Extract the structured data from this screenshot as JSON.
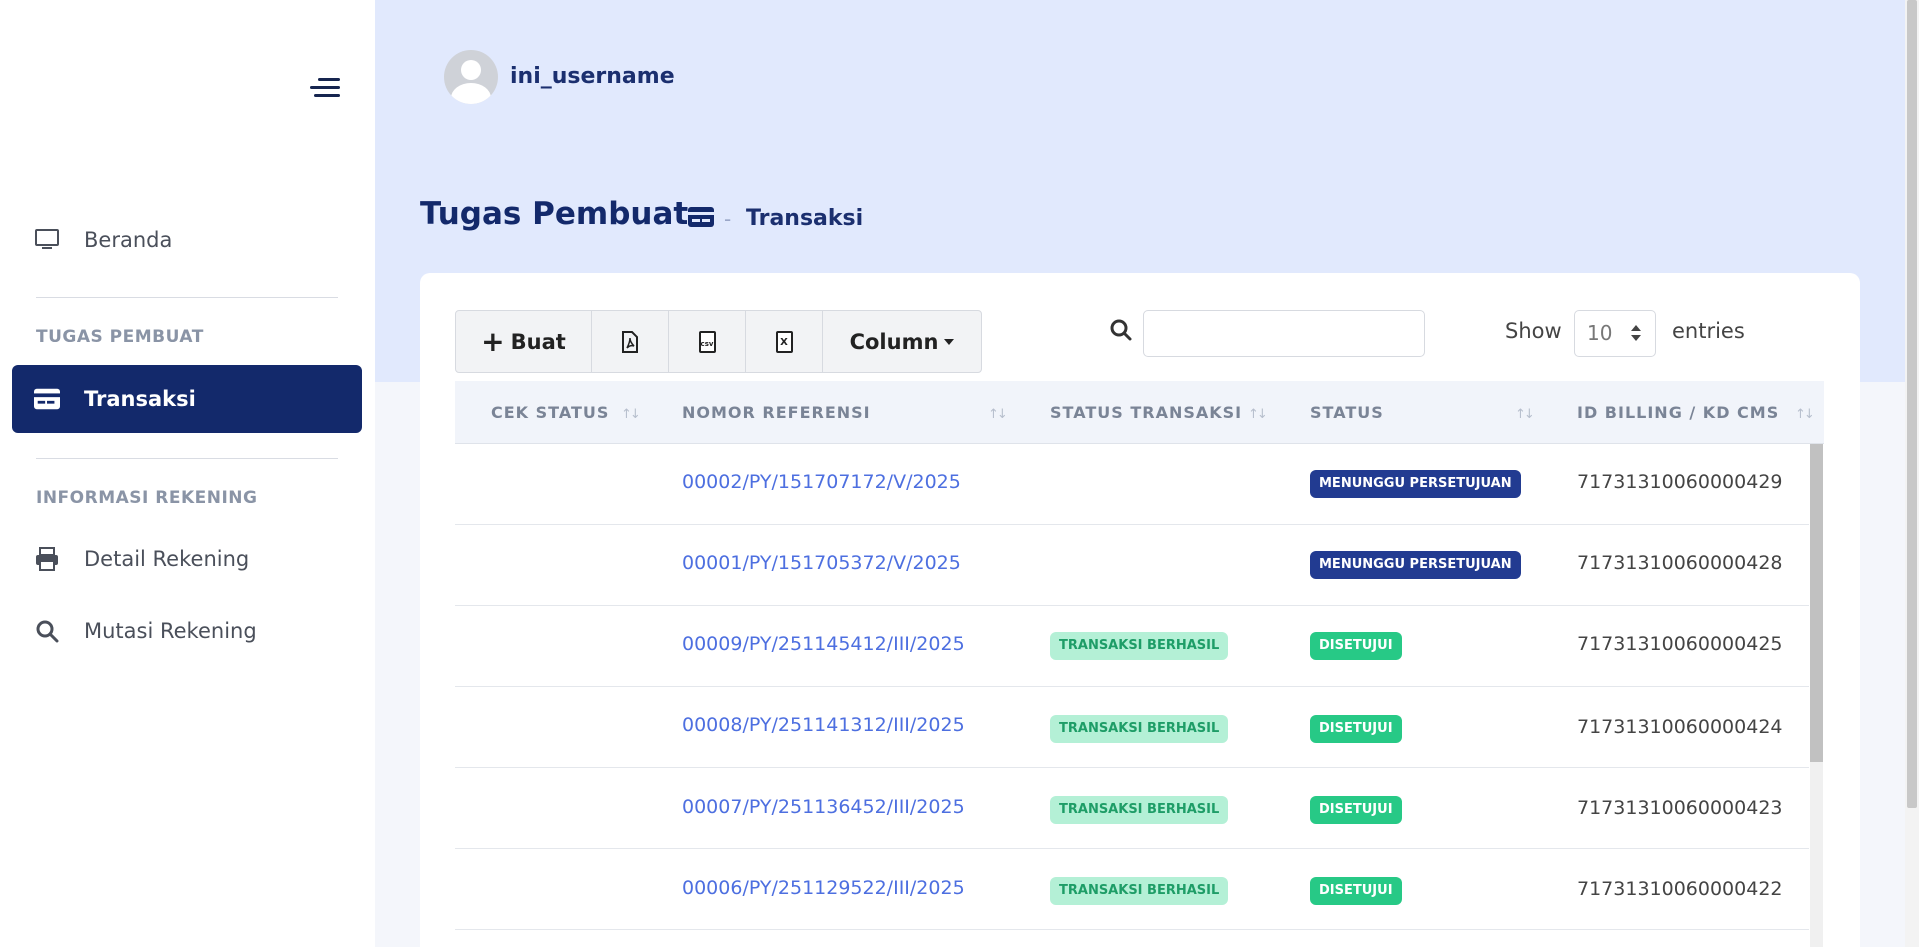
{
  "sidebar": {
    "items": [
      {
        "label": "Beranda",
        "icon": "monitor-icon"
      },
      {
        "label": "Transaksi",
        "icon": "card-icon"
      },
      {
        "label": "Detail Rekening",
        "icon": "printer-icon"
      },
      {
        "label": "Mutasi Rekening",
        "icon": "search-icon"
      }
    ],
    "sections": {
      "tugas": "TUGAS PEMBUAT",
      "informasi": "INFORMASI REKENING"
    },
    "active_color": "#13296b"
  },
  "header": {
    "username": "ini_username"
  },
  "page": {
    "title": "Tugas Pembuat",
    "breadcrumb_sep": "-",
    "breadcrumb": "Transaksi"
  },
  "toolbar": {
    "buat_label": "Buat",
    "pdf_icon": "file-pdf-icon",
    "csv_icon": "file-csv-icon",
    "excel_icon": "file-excel-icon",
    "csv_tag": "csv",
    "excel_tag": "X",
    "column_label": "Column"
  },
  "search": {
    "placeholder": ""
  },
  "entries": {
    "show": "Show",
    "value": "10",
    "suffix": "entries"
  },
  "table": {
    "columns": [
      "CEK STATUS",
      "NOMOR REFERENSI",
      "STATUS TRANSAKSI",
      "STATUS",
      "ID BILLING / KD CMS"
    ],
    "sort_glyph": "↑↓",
    "rows": [
      {
        "ref": "00002/PY/151707172/V/2025",
        "trx_status": "",
        "status": "MENUNGGU PERSETUJUAN",
        "id_billing": "71731310060000429"
      },
      {
        "ref": "00001/PY/151705372/V/2025",
        "trx_status": "",
        "status": "MENUNGGU PERSETUJUAN",
        "id_billing": "71731310060000428"
      },
      {
        "ref": "00009/PY/251145412/III/2025",
        "trx_status": "TRANSAKSI BERHASIL",
        "status": "DISETUJUI",
        "id_billing": "71731310060000425"
      },
      {
        "ref": "00008/PY/251141312/III/2025",
        "trx_status": "TRANSAKSI BERHASIL",
        "status": "DISETUJUI",
        "id_billing": "71731310060000424"
      },
      {
        "ref": "00007/PY/251136452/III/2025",
        "trx_status": "TRANSAKSI BERHASIL",
        "status": "DISETUJUI",
        "id_billing": "71731310060000423"
      },
      {
        "ref": "00006/PY/251129522/III/2025",
        "trx_status": "TRANSAKSI BERHASIL",
        "status": "DISETUJUI",
        "id_billing": "71731310060000422"
      }
    ]
  }
}
